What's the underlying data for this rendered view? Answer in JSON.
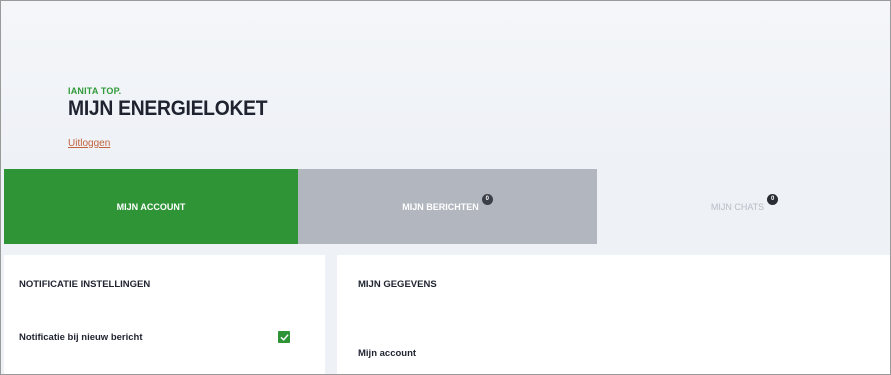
{
  "header": {
    "user_name": "IANITA TOP.",
    "page_title": "MIJN ENERGIELOKET",
    "logout_label": "Uitloggen"
  },
  "tabs": [
    {
      "label": "MIJN ACCOUNT",
      "active": true
    },
    {
      "label": "MIJN BERICHTEN",
      "badge": "0"
    },
    {
      "label": "MIJN CHATS",
      "badge": "0"
    }
  ],
  "notification_settings": {
    "heading": "NOTIFICATIE INSTELLINGEN",
    "new_message_label": "Notificatie bij nieuw bericht",
    "new_message_checked": true
  },
  "my_details": {
    "heading": "MIJN GEGEVENS",
    "account_label": "Mijn account"
  },
  "colors": {
    "accent_green": "#2e9436",
    "link_orange": "#c0623c",
    "tab_inactive_grey": "#b1b6bf"
  },
  "icons": {
    "checkbox": "checkmark-icon"
  }
}
